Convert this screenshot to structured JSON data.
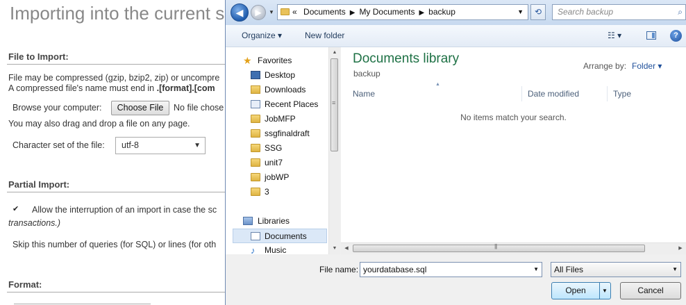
{
  "background": {
    "page_title": "Importing into the current s",
    "file_section": {
      "heading": "File to Import:",
      "line1": "File may be compressed (gzip, bzip2, zip) or uncompre",
      "line2_prefix": "A compressed file's name must end in ",
      "line2_bold": ".[format].[com",
      "browse_label": "Browse your computer:",
      "choose_button": "Choose File",
      "no_file": "No file chose",
      "drag_hint": "You may also drag and drop a file on any page.",
      "charset_label": "Character set of the file:",
      "charset_value": "utf-8"
    },
    "partial_section": {
      "heading": "Partial Import:",
      "allow_interrupt": "Allow the interruption of an import in case the sc",
      "transactions": "transactions.)",
      "skip_label": "Skip this number of queries (for SQL) or lines (for oth"
    },
    "format_section": {
      "heading": "Format:"
    }
  },
  "dialog": {
    "breadcrumb": {
      "prefix": "«",
      "items": [
        "Documents",
        "My Documents",
        "backup"
      ]
    },
    "search_placeholder": "Search backup",
    "toolbar": {
      "organize": "Organize ▾",
      "new_folder": "New folder",
      "views": "☷ ▾",
      "help": "?"
    },
    "nav": {
      "favorites": "Favorites",
      "items": [
        "Desktop",
        "Downloads",
        "Recent Places",
        "JobMFP",
        "ssgfinaldraft",
        "SSG",
        "unit7",
        "jobWP",
        "3"
      ],
      "libraries": "Libraries",
      "library_items": [
        "Documents",
        "Music"
      ]
    },
    "content": {
      "title": "Documents library",
      "subtitle": "backup",
      "arrange_label": "Arrange by:",
      "arrange_value": "Folder ▾",
      "columns": [
        "Name",
        "Date modified",
        "Type"
      ],
      "empty_message": "No items match your search."
    },
    "file_name_label": "File name:",
    "file_name_value": "yourdatabase.sql",
    "file_type": "All Files",
    "open_button": "Open",
    "cancel_button": "Cancel"
  }
}
